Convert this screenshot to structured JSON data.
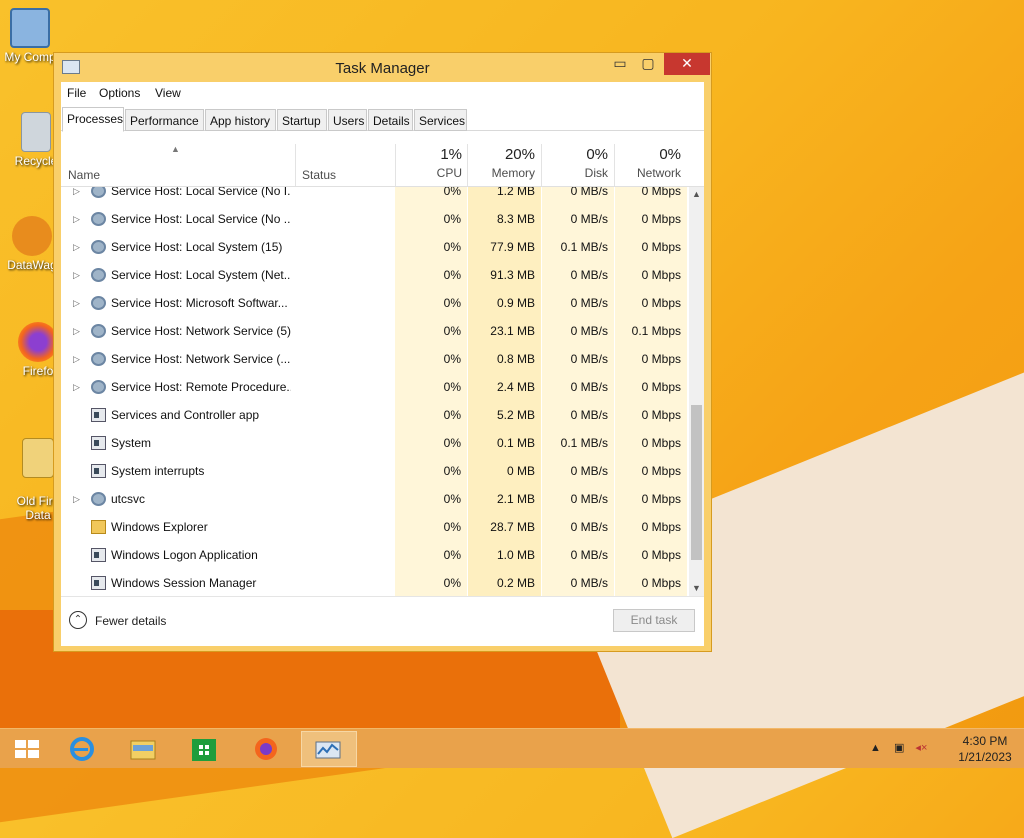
{
  "desktop": {
    "icons": [
      {
        "label": "My Comp"
      },
      {
        "label": "Recycle"
      },
      {
        "label": "DataWag"
      },
      {
        "label": "Firefo"
      },
      {
        "label": "Old Fire\nData"
      }
    ]
  },
  "window": {
    "title": "Task Manager",
    "minimize": "▭",
    "maximize": "▢",
    "close": "✕"
  },
  "menu": [
    "File",
    "Options",
    "View"
  ],
  "tabs": [
    "Processes",
    "Performance",
    "App history",
    "Startup",
    "Users",
    "Details",
    "Services"
  ],
  "active_tab": "Processes",
  "columns": {
    "name": "Name",
    "status": "Status",
    "cpu": {
      "percent": "1%",
      "label": "CPU"
    },
    "memory": {
      "percent": "20%",
      "label": "Memory"
    },
    "disk": {
      "percent": "0%",
      "label": "Disk"
    },
    "network": {
      "percent": "0%",
      "label": "Network"
    }
  },
  "processes": [
    {
      "name": "Service Host: Local Service (No I...",
      "expand": true,
      "icon": "gear-icon",
      "cpu": "0%",
      "memory": "1.2 MB",
      "disk": "0 MB/s",
      "network": "0 Mbps"
    },
    {
      "name": "Service Host: Local Service (No ...",
      "expand": true,
      "icon": "gear-icon",
      "cpu": "0%",
      "memory": "8.3 MB",
      "disk": "0 MB/s",
      "network": "0 Mbps"
    },
    {
      "name": "Service Host: Local System (15)",
      "expand": true,
      "icon": "gear-icon",
      "cpu": "0%",
      "memory": "77.9 MB",
      "disk": "0.1 MB/s",
      "network": "0 Mbps"
    },
    {
      "name": "Service Host: Local System (Net...",
      "expand": true,
      "icon": "gear-icon",
      "cpu": "0%",
      "memory": "91.3 MB",
      "disk": "0 MB/s",
      "network": "0 Mbps"
    },
    {
      "name": "Service Host: Microsoft Softwar...",
      "expand": true,
      "icon": "gear-icon",
      "cpu": "0%",
      "memory": "0.9 MB",
      "disk": "0 MB/s",
      "network": "0 Mbps"
    },
    {
      "name": "Service Host: Network Service (5)",
      "expand": true,
      "icon": "gear-icon",
      "cpu": "0%",
      "memory": "23.1 MB",
      "disk": "0 MB/s",
      "network": "0.1 Mbps"
    },
    {
      "name": "Service Host: Network Service (...",
      "expand": true,
      "icon": "gear-icon",
      "cpu": "0%",
      "memory": "0.8 MB",
      "disk": "0 MB/s",
      "network": "0 Mbps"
    },
    {
      "name": "Service Host: Remote Procedure...",
      "expand": true,
      "icon": "gear-icon",
      "cpu": "0%",
      "memory": "2.4 MB",
      "disk": "0 MB/s",
      "network": "0 Mbps"
    },
    {
      "name": "Services and Controller app",
      "expand": false,
      "icon": "window-icon",
      "cpu": "0%",
      "memory": "5.2 MB",
      "disk": "0 MB/s",
      "network": "0 Mbps"
    },
    {
      "name": "System",
      "expand": false,
      "icon": "window-icon",
      "cpu": "0%",
      "memory": "0.1 MB",
      "disk": "0.1 MB/s",
      "network": "0 Mbps"
    },
    {
      "name": "System interrupts",
      "expand": false,
      "icon": "window-icon",
      "cpu": "0%",
      "memory": "0 MB",
      "disk": "0 MB/s",
      "network": "0 Mbps"
    },
    {
      "name": "utcsvc",
      "expand": true,
      "icon": "gear-icon",
      "cpu": "0%",
      "memory": "2.1 MB",
      "disk": "0 MB/s",
      "network": "0 Mbps"
    },
    {
      "name": "Windows Explorer",
      "expand": false,
      "icon": "folder-icon",
      "cpu": "0%",
      "memory": "28.7 MB",
      "disk": "0 MB/s",
      "network": "0 Mbps"
    },
    {
      "name": "Windows Logon Application",
      "expand": false,
      "icon": "window-icon",
      "cpu": "0%",
      "memory": "1.0 MB",
      "disk": "0 MB/s",
      "network": "0 Mbps"
    },
    {
      "name": "Windows Session Manager",
      "expand": false,
      "icon": "window-icon",
      "cpu": "0%",
      "memory": "0.2 MB",
      "disk": "0 MB/s",
      "network": "0 Mbps"
    }
  ],
  "footer": {
    "fewer_details": "Fewer details",
    "end_task": "End task"
  },
  "taskbar": {
    "items": [
      "start-icon",
      "internet-explorer-icon",
      "file-explorer-icon",
      "store-icon",
      "firefox-icon",
      "task-manager-icon"
    ],
    "clock_time": "4:30 PM",
    "clock_date": "1/21/2023"
  },
  "colors": {
    "accent": "#f9cf6a",
    "close": "#c7372f",
    "heat_light": "#fff6d9",
    "heat_mem": "#feefc0"
  }
}
